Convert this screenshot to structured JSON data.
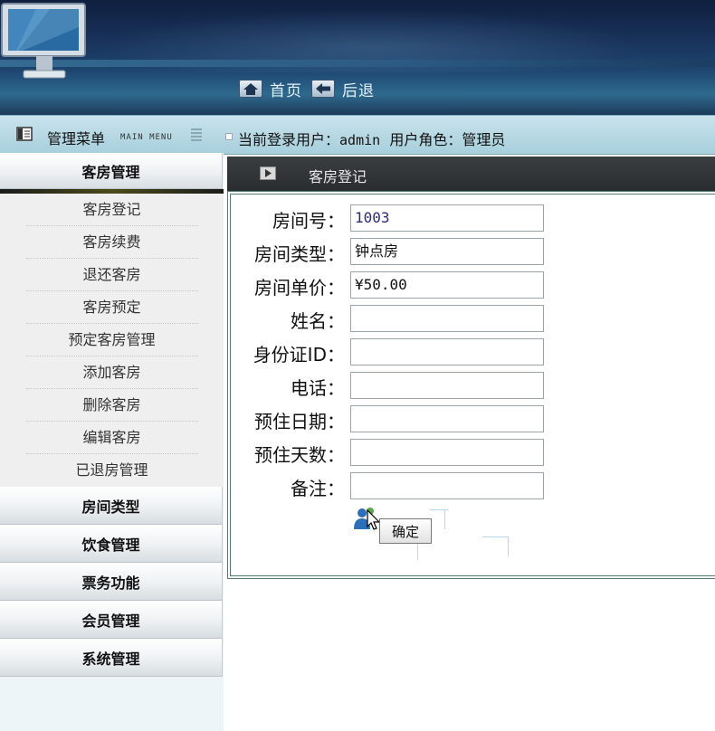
{
  "nav": {
    "home_label": "首页",
    "back_label": "后退"
  },
  "statusbar": {
    "menu_title": "管理菜单",
    "menu_sub": "MAIN MENU",
    "login_prefix": "当前登录用户：",
    "username": "admin",
    "role_prefix": "用户角色：",
    "role": "管理员"
  },
  "sidebar": {
    "groups": [
      {
        "label": "客房管理",
        "expanded": true
      },
      {
        "label": "房间类型",
        "expanded": false
      },
      {
        "label": "饮食管理",
        "expanded": false
      },
      {
        "label": "票务功能",
        "expanded": false
      },
      {
        "label": "会员管理",
        "expanded": false
      },
      {
        "label": "系统管理",
        "expanded": false
      }
    ],
    "items": [
      "客房登记",
      "客房续费",
      "退还客房",
      "客房预定",
      "预定客房管理",
      "添加客房",
      "删除客房",
      "编辑客房",
      "已退房管理"
    ]
  },
  "content": {
    "title": "客房登记",
    "fields": [
      {
        "label": "房间号：",
        "value": "1003"
      },
      {
        "label": "房间类型：",
        "value": "钟点房"
      },
      {
        "label": "房间单价：",
        "value": "¥50.00"
      },
      {
        "label": "姓名：",
        "value": ""
      },
      {
        "label": "身份证ID：",
        "value": ""
      },
      {
        "label": "电话：",
        "value": ""
      },
      {
        "label": "预住日期：",
        "value": ""
      },
      {
        "label": "预住天数：",
        "value": ""
      },
      {
        "label": "备注：",
        "value": ""
      }
    ],
    "submit_label": "确定"
  },
  "colors": {
    "banner": "#18325a",
    "statusbar": "#a7cfdc",
    "content_header": "#2f3235",
    "panel_border": "#4f7d75"
  }
}
